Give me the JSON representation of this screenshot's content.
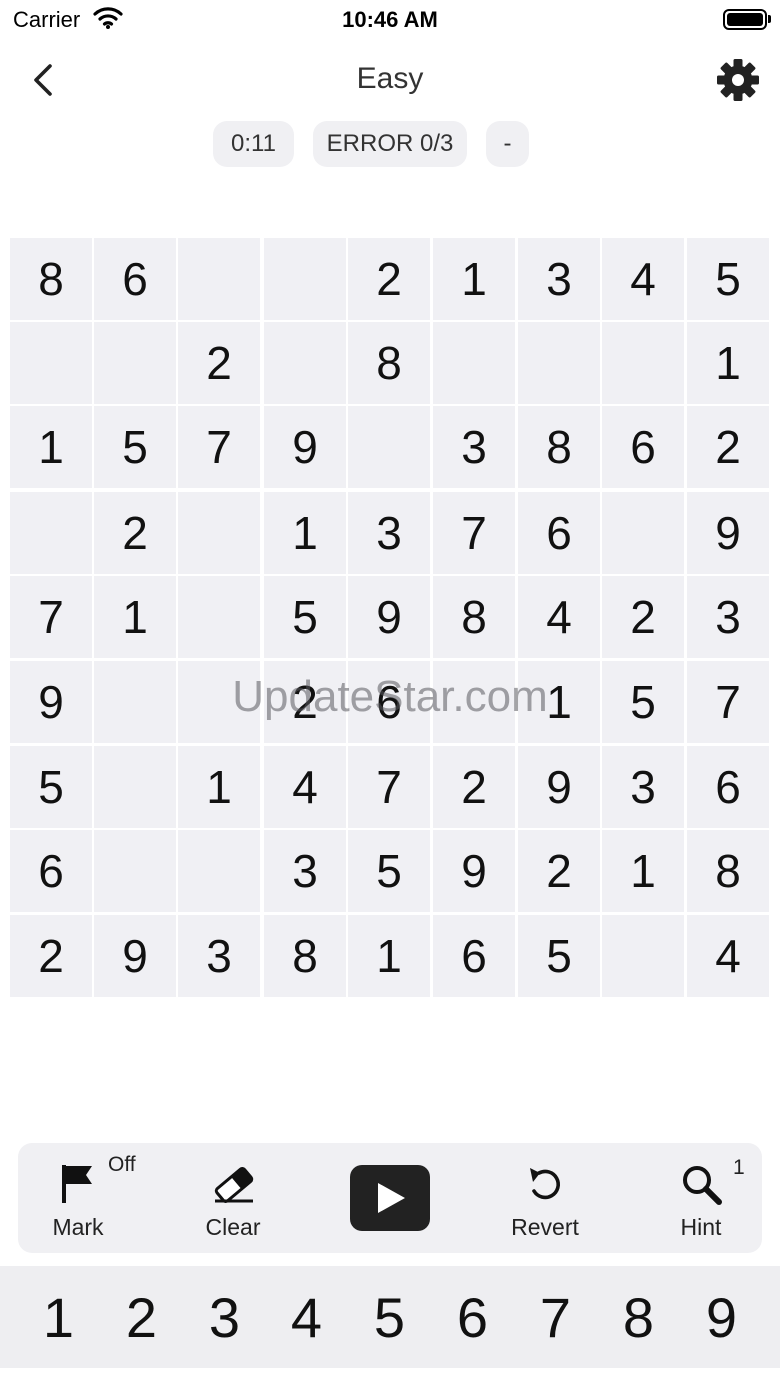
{
  "status_bar": {
    "carrier": "Carrier",
    "time": "10:46 AM"
  },
  "nav": {
    "title": "Easy",
    "back_icon": "chevron-left-icon",
    "settings_icon": "gear-icon"
  },
  "info": {
    "timer": "0:11",
    "errors": "ERROR 0/3",
    "pause": "-"
  },
  "board": [
    [
      "8",
      "6",
      "",
      "",
      "2",
      "1",
      "3",
      "4",
      "5"
    ],
    [
      "",
      "",
      "2",
      "",
      "8",
      "",
      "",
      "",
      "1"
    ],
    [
      "1",
      "5",
      "7",
      "9",
      "",
      "3",
      "8",
      "6",
      "2"
    ],
    [
      "",
      "2",
      "",
      "1",
      "3",
      "7",
      "6",
      "",
      "9"
    ],
    [
      "7",
      "1",
      "",
      "5",
      "9",
      "8",
      "4",
      "2",
      "3"
    ],
    [
      "9",
      "",
      "",
      "2",
      "6",
      "",
      "1",
      "5",
      "7"
    ],
    [
      "5",
      "",
      "1",
      "4",
      "7",
      "2",
      "9",
      "3",
      "6"
    ],
    [
      "6",
      "",
      "",
      "3",
      "5",
      "9",
      "2",
      "1",
      "8"
    ],
    [
      "2",
      "9",
      "3",
      "8",
      "1",
      "6",
      "5",
      "",
      "4"
    ]
  ],
  "watermark": "UpdateStar.com",
  "toolbar": {
    "mark": {
      "label": "Mark",
      "state": "Off",
      "icon": "flag-icon"
    },
    "clear": {
      "label": "Clear",
      "icon": "eraser-icon"
    },
    "play": {
      "icon": "play-icon"
    },
    "revert": {
      "label": "Revert",
      "icon": "undo-icon"
    },
    "hint": {
      "label": "Hint",
      "count": "1",
      "icon": "magnifier-icon"
    }
  },
  "numpad": [
    "1",
    "2",
    "3",
    "4",
    "5",
    "6",
    "7",
    "8",
    "9"
  ]
}
